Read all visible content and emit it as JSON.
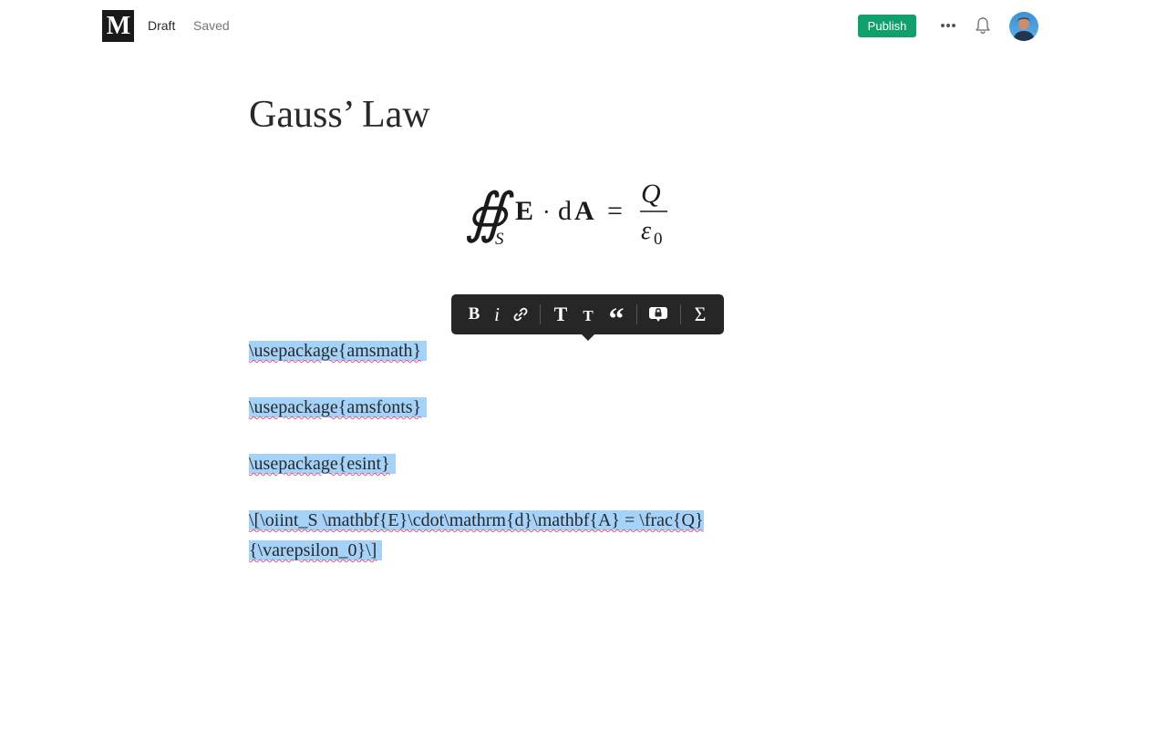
{
  "header": {
    "logo_letter": "M",
    "draft_label": "Draft",
    "saved_label": "Saved",
    "publish_label": "Publish",
    "more_icon": "ellipsis-icon",
    "notifications_icon": "bell-icon",
    "accent_color": "#11a06b"
  },
  "article": {
    "title": "Gauss’ Law",
    "equation": {
      "integral": "∯",
      "subscript": "S",
      "field": "E",
      "dot": "·",
      "differential": "d",
      "area": "A",
      "equals": "=",
      "numerator": "Q",
      "denominator": "ε",
      "denominator_sub": "0"
    },
    "paragraphs": [
      "\\usepackage{amsmath}",
      "\\usepackage{amsfonts}",
      "\\usepackage{esint}",
      "\\[\\oiint_S \\mathbf{E}\\cdot\\mathrm{d}\\mathbf{A} = \\frac{Q}{\\varepsilon_0}\\]"
    ],
    "selection_color": "#a5d2f8"
  },
  "toolbar": {
    "bold_label": "B",
    "italic_label": "i",
    "big_heading_label": "T",
    "small_heading_label": "T",
    "quote_label": "“",
    "math_label": "Σ",
    "icons": [
      "bold-icon",
      "italic-icon",
      "link-icon",
      "large-title-icon",
      "small-title-icon",
      "quote-icon",
      "private-note-icon",
      "sigma-icon"
    ]
  }
}
